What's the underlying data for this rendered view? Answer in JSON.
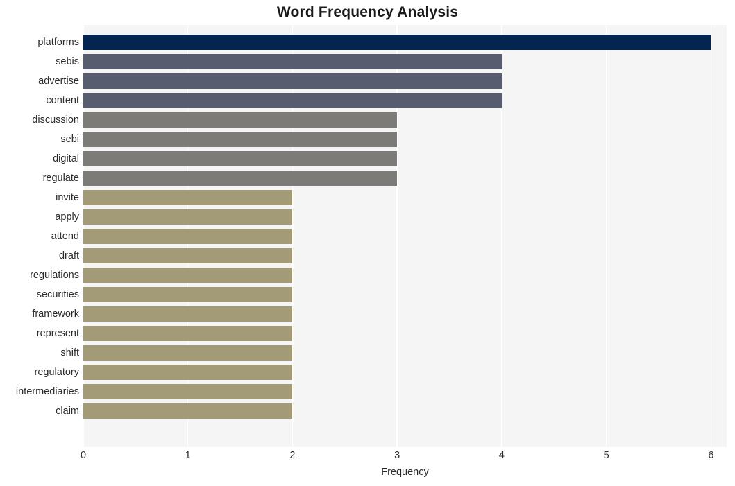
{
  "chart_data": {
    "type": "bar",
    "orientation": "horizontal",
    "title": "Word Frequency Analysis",
    "xlabel": "Frequency",
    "ylabel": "",
    "xlim": [
      0,
      6.15
    ],
    "xticks": [
      "0",
      "1",
      "2",
      "3",
      "4",
      "5",
      "6"
    ],
    "xtick_values": [
      0,
      1,
      2,
      3,
      4,
      5,
      6
    ],
    "grid": "vertical-white-on-light",
    "legend": "none",
    "categories": [
      "platforms",
      "sebis",
      "advertise",
      "content",
      "discussion",
      "sebi",
      "digital",
      "regulate",
      "invite",
      "apply",
      "attend",
      "draft",
      "regulations",
      "securities",
      "framework",
      "represent",
      "shift",
      "regulatory",
      "intermediaries",
      "claim"
    ],
    "values": [
      6,
      4,
      4,
      4,
      3,
      3,
      3,
      3,
      2,
      2,
      2,
      2,
      2,
      2,
      2,
      2,
      2,
      2,
      2,
      2
    ],
    "bar_colors": [
      "#04254f",
      "#575c6e",
      "#575c6e",
      "#575c6e",
      "#7c7b78",
      "#7c7b78",
      "#7c7b78",
      "#7c7b78",
      "#a39b77",
      "#a39b77",
      "#a39b77",
      "#a39b77",
      "#a39b77",
      "#a39b77",
      "#a39b77",
      "#a39b77",
      "#a39b77",
      "#a39b77",
      "#a39b77",
      "#a39b77"
    ]
  },
  "style": {
    "plot_background": "#f5f5f6",
    "figure_background": "#ffffff",
    "gridline_color": "#ffffff",
    "text_color": "#2b2b2b",
    "title_color": "#1a1a1a"
  }
}
